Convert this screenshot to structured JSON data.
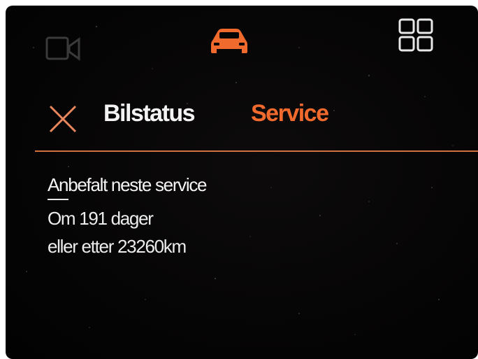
{
  "topbar": {
    "left_icon": "camera-icon",
    "center_icon": "car-icon",
    "right_icon": "app-grid-icon"
  },
  "tabs": [
    {
      "label": "Bilstatus",
      "active": false
    },
    {
      "label": "Service",
      "active": true
    }
  ],
  "service": {
    "heading": "Anbefalt neste service",
    "days_line": "Om 191 dager",
    "distance_line": "eller etter 23260km"
  },
  "colors": {
    "accent": "#f06a2d",
    "text": "#f3f3f3",
    "background": "#060505"
  }
}
